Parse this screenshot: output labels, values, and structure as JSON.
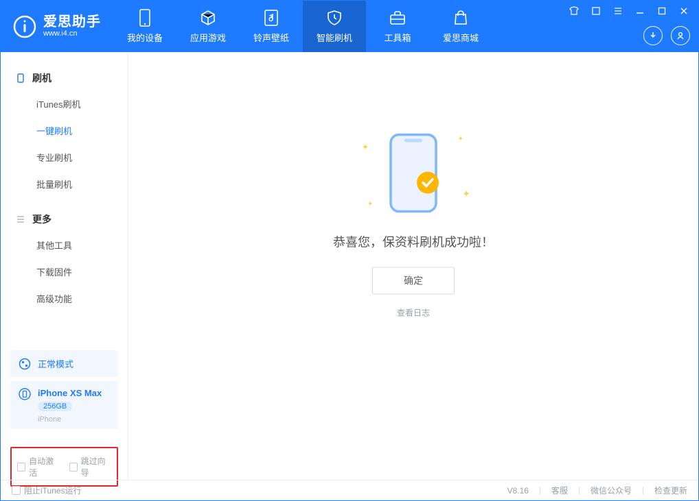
{
  "app": {
    "name_cn": "爱思助手",
    "site": "www.i4.cn",
    "version": "V8.16"
  },
  "tabs": [
    {
      "label": "我的设备",
      "icon": "device-icon"
    },
    {
      "label": "应用游戏",
      "icon": "cube-icon"
    },
    {
      "label": "铃声壁纸",
      "icon": "music-icon"
    },
    {
      "label": "智能刷机",
      "icon": "shield-icon",
      "active": true
    },
    {
      "label": "工具箱",
      "icon": "toolbox-icon"
    },
    {
      "label": "爱思商城",
      "icon": "bag-icon"
    }
  ],
  "sidebar": {
    "groups": [
      {
        "title": "刷机",
        "icon": "phone-outline-icon",
        "items": [
          {
            "label": "iTunes刷机"
          },
          {
            "label": "一键刷机",
            "selected": true
          },
          {
            "label": "专业刷机"
          },
          {
            "label": "批量刷机"
          }
        ]
      },
      {
        "title": "更多",
        "icon": "list-icon",
        "items": [
          {
            "label": "其他工具"
          },
          {
            "label": "下载固件"
          },
          {
            "label": "高级功能"
          }
        ]
      }
    ]
  },
  "mode_card": {
    "label": "正常模式"
  },
  "device": {
    "name": "iPhone XS Max",
    "capacity": "256GB",
    "type": "iPhone"
  },
  "options": {
    "auto_activate": "自动激活",
    "skip_guide": "跳过向导"
  },
  "main": {
    "success_title": "恭喜您，保资料刷机成功啦！",
    "ok": "确定",
    "view_log": "查看日志"
  },
  "status": {
    "block_itunes": "阻止iTunes运行",
    "support": "客服",
    "wechat": "微信公众号",
    "check_update": "检查更新"
  }
}
